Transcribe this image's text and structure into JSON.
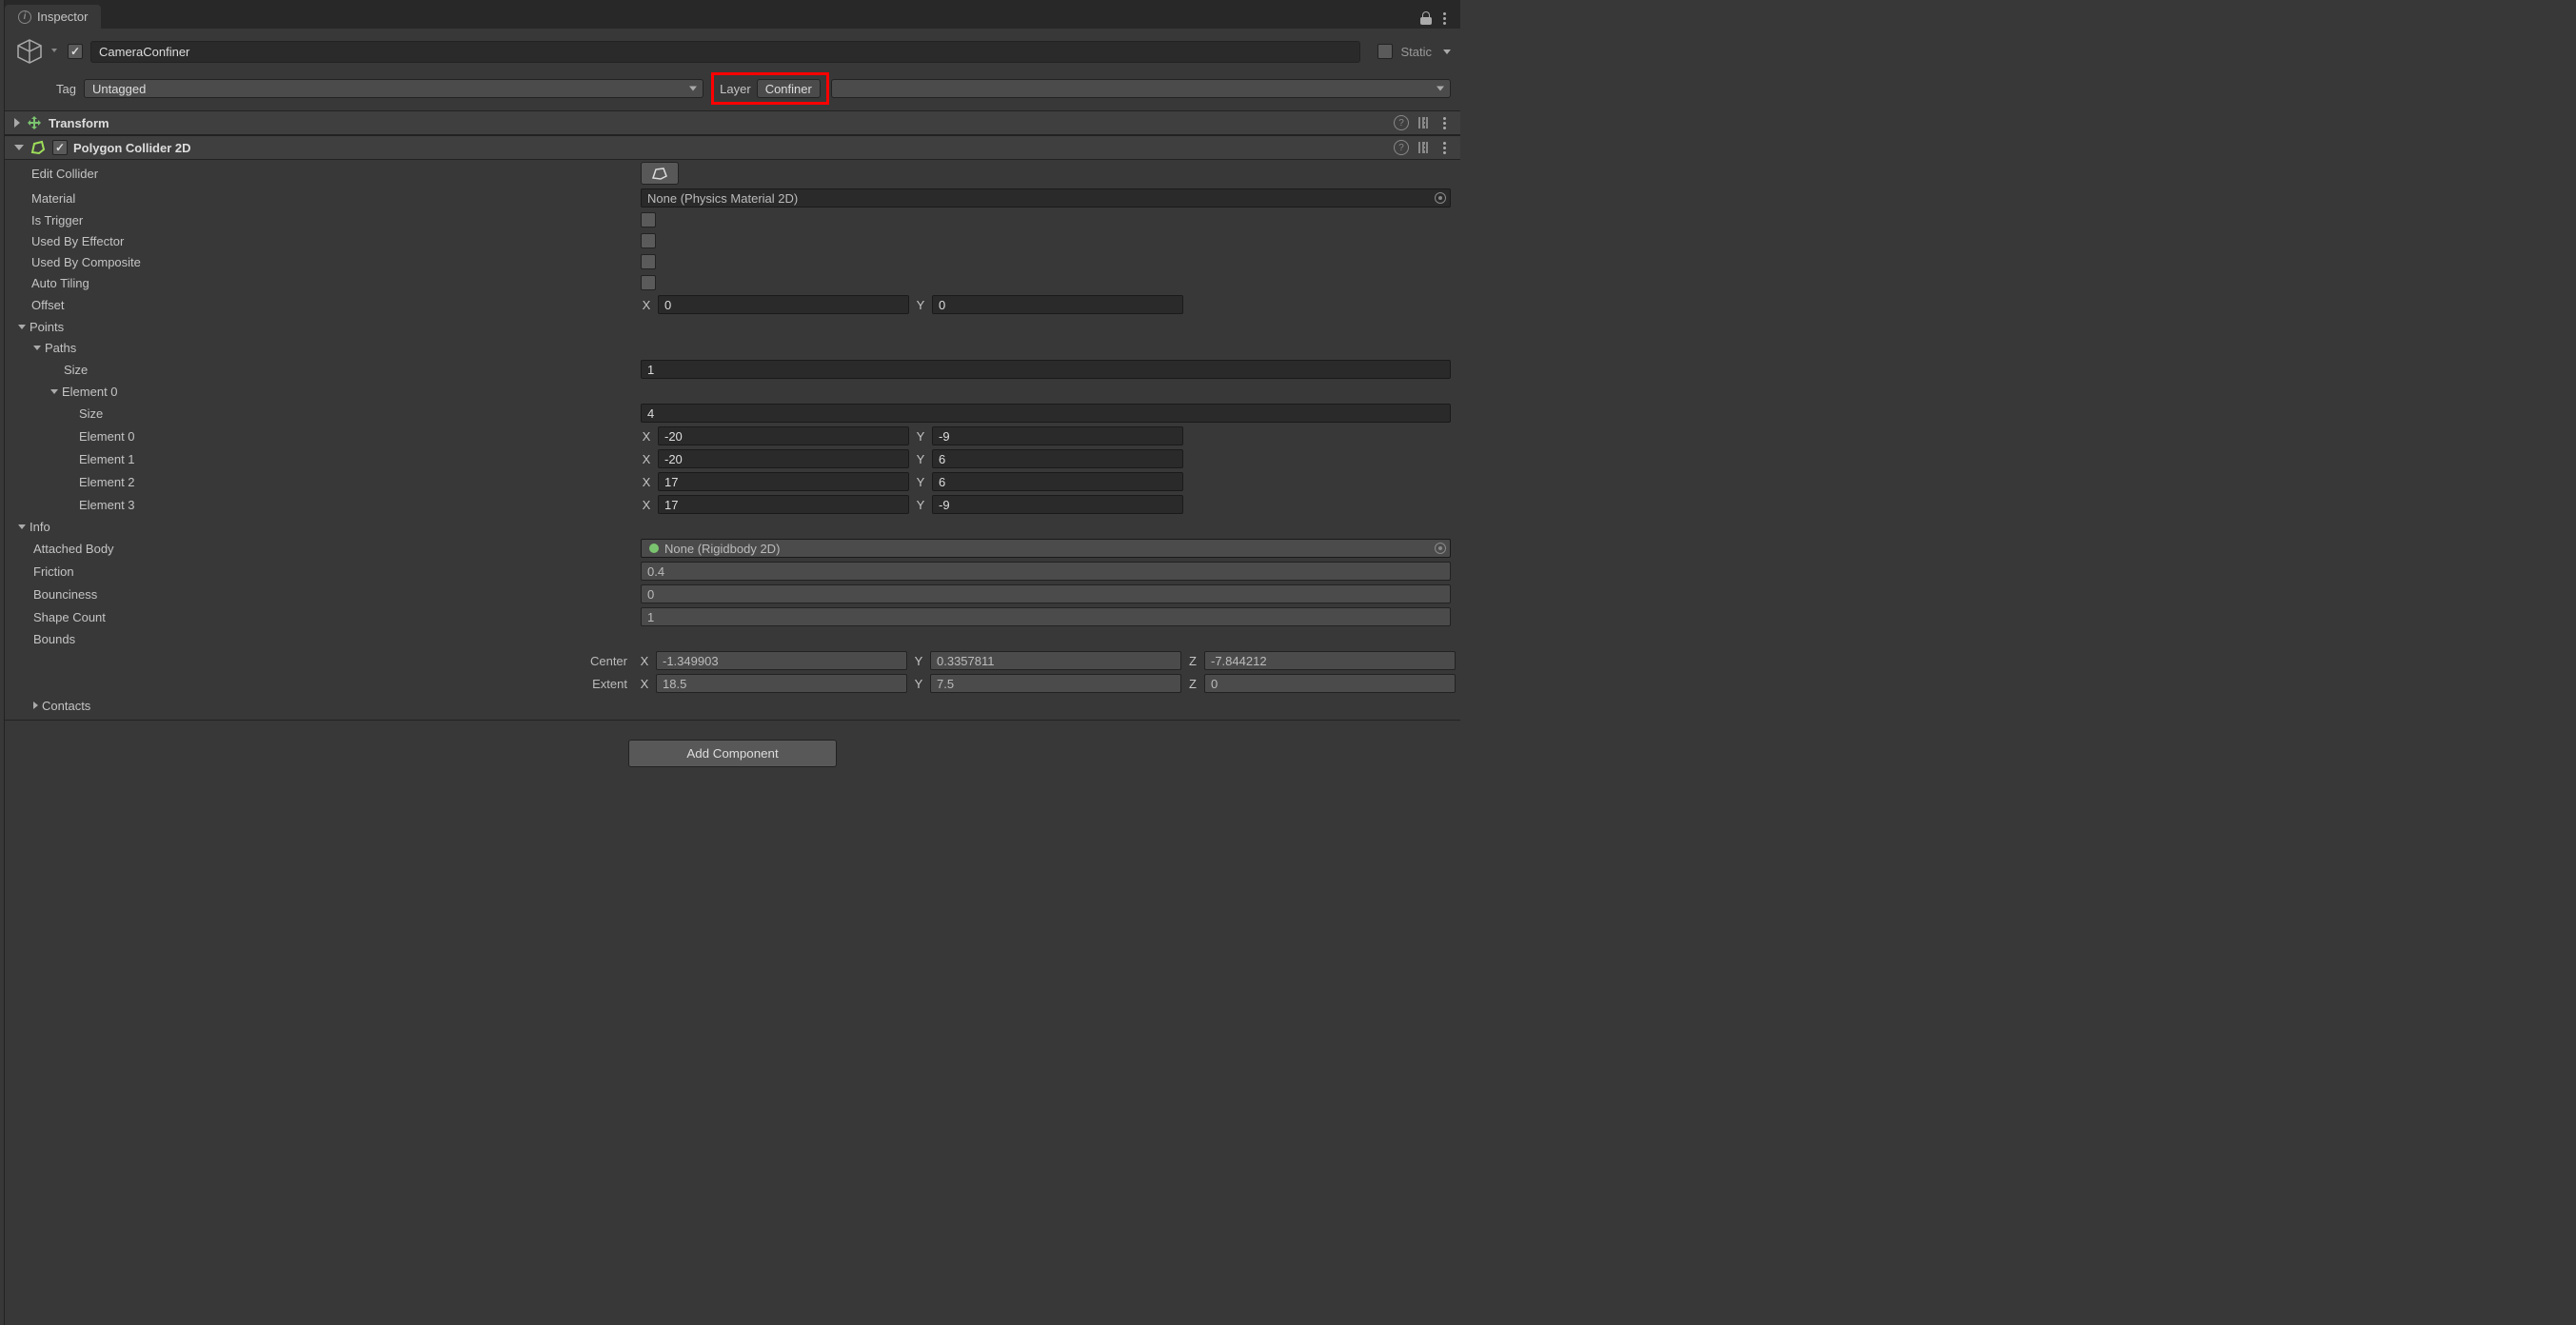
{
  "tab": "Inspector",
  "object": {
    "enabled": true,
    "name": "CameraConfiner",
    "static_label": "Static",
    "tag_label": "Tag",
    "tag_value": "Untagged",
    "layer_label": "Layer",
    "layer_value": "Confiner"
  },
  "transform": {
    "title": "Transform"
  },
  "collider": {
    "title": "Polygon Collider 2D",
    "enabled": true,
    "edit_collider_label": "Edit Collider",
    "material_label": "Material",
    "material_value": "None (Physics Material 2D)",
    "is_trigger_label": "Is Trigger",
    "used_by_effector_label": "Used By Effector",
    "used_by_composite_label": "Used By Composite",
    "auto_tiling_label": "Auto Tiling",
    "offset_label": "Offset",
    "offset_x": "0",
    "offset_y": "0",
    "points_label": "Points",
    "paths_label": "Paths",
    "size_label": "Size",
    "paths_size": "1",
    "element0_label": "Element 0",
    "element0_size": "4",
    "elements": [
      {
        "label": "Element 0",
        "x": "-20",
        "y": "-9"
      },
      {
        "label": "Element 1",
        "x": "-20",
        "y": "6"
      },
      {
        "label": "Element 2",
        "x": "17",
        "y": "6"
      },
      {
        "label": "Element 3",
        "x": "17",
        "y": "-9"
      }
    ],
    "info_label": "Info",
    "attached_body_label": "Attached Body",
    "attached_body_value": "None (Rigidbody 2D)",
    "friction_label": "Friction",
    "friction_value": "0.4",
    "bounciness_label": "Bounciness",
    "bounciness_value": "0",
    "shape_count_label": "Shape Count",
    "shape_count_value": "1",
    "bounds_label": "Bounds",
    "center_label": "Center",
    "center_x": "-1.349903",
    "center_y": "0.3357811",
    "center_z": "-7.844212",
    "extent_label": "Extent",
    "extent_x": "18.5",
    "extent_y": "7.5",
    "extent_z": "0",
    "contacts_label": "Contacts"
  },
  "add_component_label": "Add Component"
}
